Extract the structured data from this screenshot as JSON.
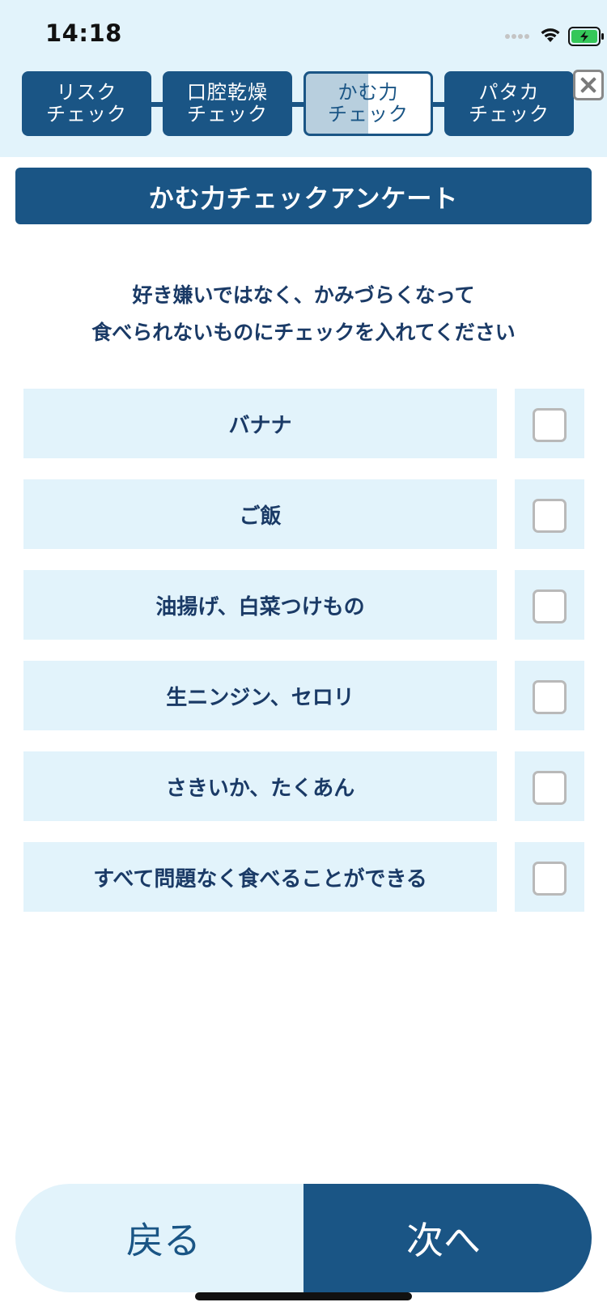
{
  "status_bar": {
    "time": "14:18"
  },
  "steps": [
    {
      "line1": "リスク",
      "line2": "チェック",
      "active": false
    },
    {
      "line1": "口腔乾燥",
      "line2": "チェック",
      "active": false
    },
    {
      "line1": "かむ力",
      "line2": "チェック",
      "active": true
    },
    {
      "line1": "パタカ",
      "line2": "チェック",
      "active": false
    }
  ],
  "close_icon": "close-x-icon",
  "header": {
    "title": "かむ力チェックアンケート"
  },
  "instructions": {
    "line1": "好き嫌いではなく、かみづらくなって",
    "line2": "食べられないものにチェックを入れてください"
  },
  "items": [
    {
      "label": "バナナ",
      "checked": false
    },
    {
      "label": "ご飯",
      "checked": false
    },
    {
      "label": "油揚げ、白菜つけもの",
      "checked": false
    },
    {
      "label": "生ニンジン、セロリ",
      "checked": false
    },
    {
      "label": "さきいか、たくあん",
      "checked": false
    },
    {
      "label": "すべて問題なく食べることができる",
      "checked": false
    }
  ],
  "footer": {
    "back_label": "戻る",
    "next_label": "次へ"
  },
  "colors": {
    "primary": "#1a5585",
    "light": "#e2f3fb",
    "text": "#1a3a66",
    "battery": "#34c759"
  }
}
